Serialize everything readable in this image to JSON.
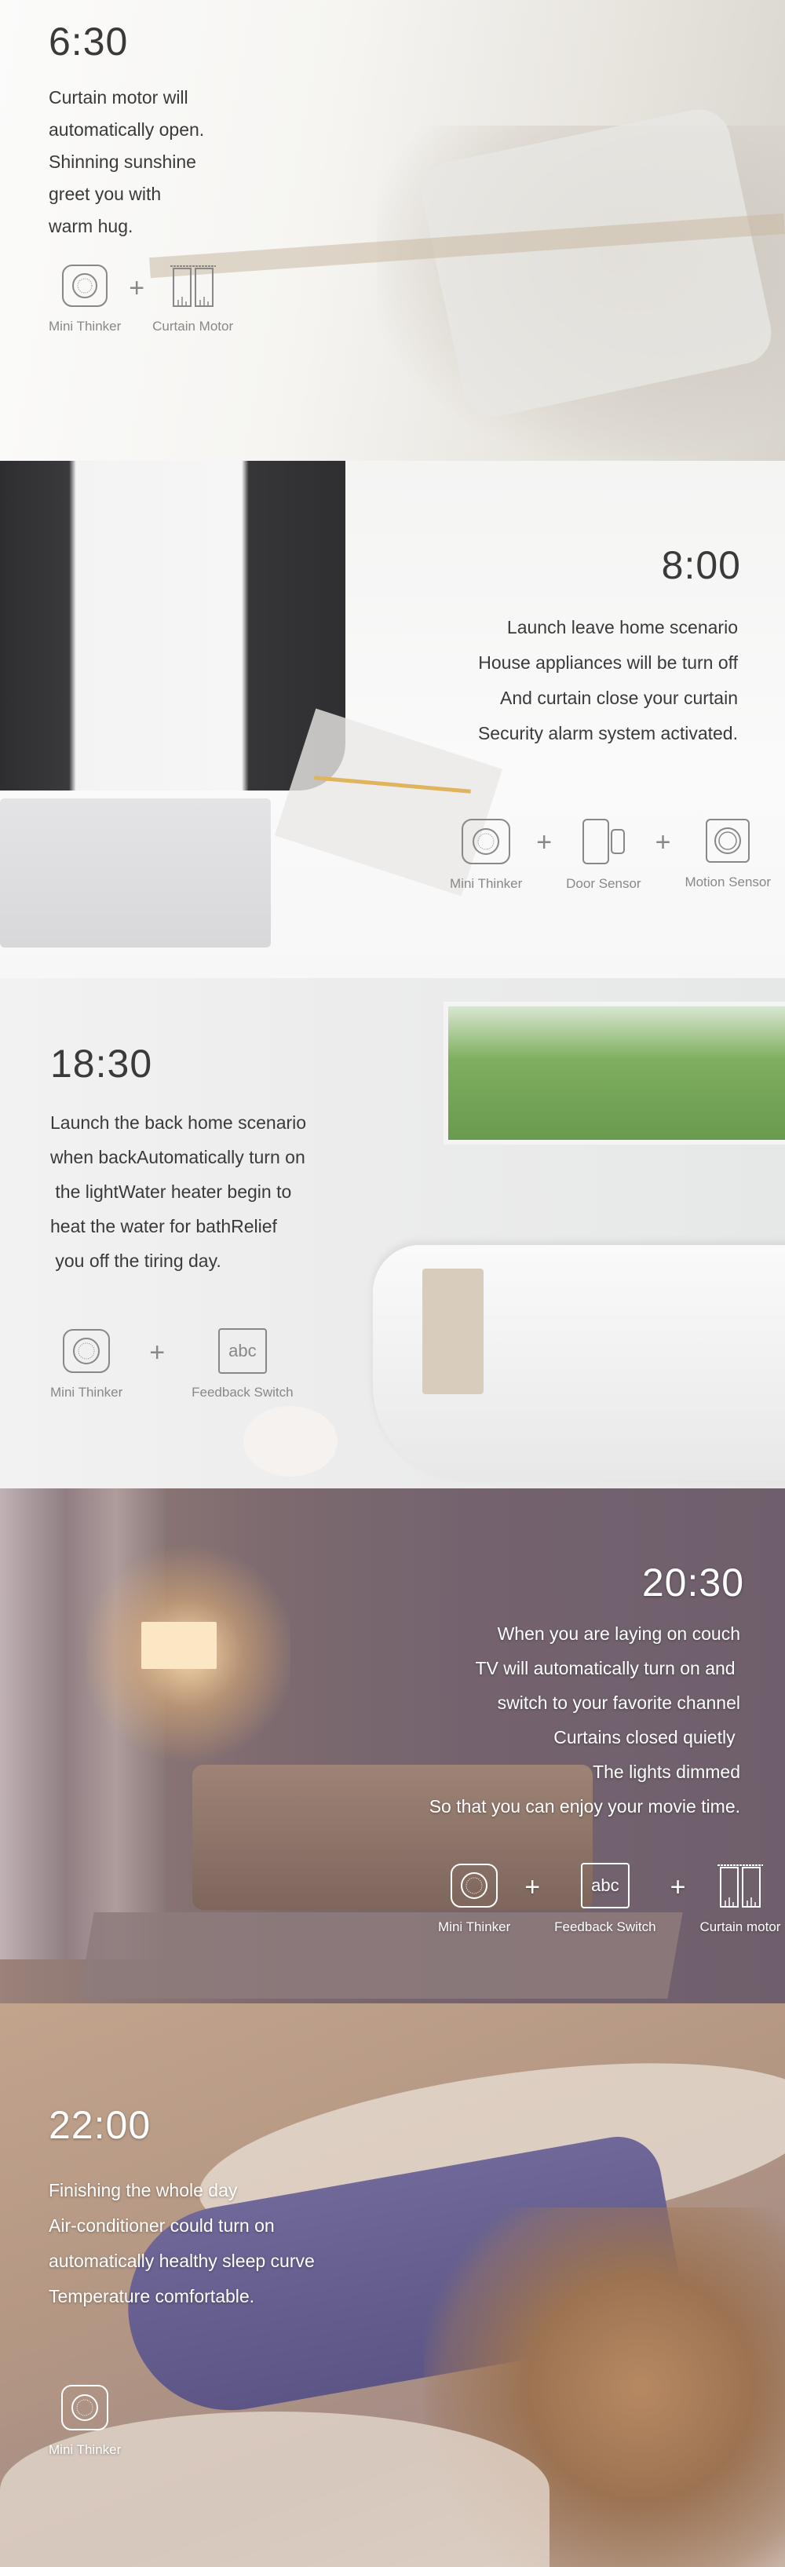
{
  "scenes": [
    {
      "time": "6:30",
      "lines": [
        "Curtain motor will",
        "automatically open.",
        "Shinning sunshine",
        "greet you with",
        "warm hug."
      ],
      "devices": [
        {
          "icon": "mini-thinker-icon",
          "label": "Mini Thinker"
        },
        {
          "icon": "curtain-motor-icon",
          "label": "Curtain Motor"
        }
      ]
    },
    {
      "time": "8:00",
      "lines": [
        "Launch leave home scenario",
        "House appliances will be turn off",
        "And curtain close your curtain",
        "Security alarm system activated."
      ],
      "devices": [
        {
          "icon": "mini-thinker-icon",
          "label": "Mini Thinker"
        },
        {
          "icon": "door-sensor-icon",
          "label": "Door Sensor"
        },
        {
          "icon": "motion-sensor-icon",
          "label": "Motion Sensor"
        }
      ]
    },
    {
      "time": "18:30",
      "lines": [
        "Launch the back home scenario",
        "when backAutomatically turn on",
        " the lightWater heater begin to",
        "heat the water for bathRelief",
        " you off the tiring day."
      ],
      "devices": [
        {
          "icon": "mini-thinker-icon",
          "label": "Mini Thinker"
        },
        {
          "icon": "feedback-switch-icon",
          "label": "Feedback Switch",
          "glyph": "abc"
        }
      ]
    },
    {
      "time": "20:30",
      "lines": [
        "When you are laying on couch",
        "TV will automatically turn on and ",
        "switch to your favorite channel",
        "Curtains closed quietly ",
        "The lights dimmed",
        "So that you can enjoy your movie time."
      ],
      "devices": [
        {
          "icon": "mini-thinker-icon",
          "label": "Mini Thinker"
        },
        {
          "icon": "feedback-switch-icon",
          "label": "Feedback Switch",
          "glyph": "abc"
        },
        {
          "icon": "curtain-motor-icon",
          "label": "Curtain motor"
        }
      ]
    },
    {
      "time": "22:00",
      "lines": [
        "Finishing the whole day",
        "Air-conditioner could turn on",
        "automatically healthy sleep curve",
        "Temperature comfortable."
      ],
      "devices": [
        {
          "icon": "mini-thinker-icon",
          "label": "Mini Thinker"
        }
      ]
    }
  ],
  "plus_sign": "+",
  "colors": {
    "dark_text": "#3a3a3a",
    "icon_gray": "#888888",
    "light_text": "#ffffff"
  }
}
